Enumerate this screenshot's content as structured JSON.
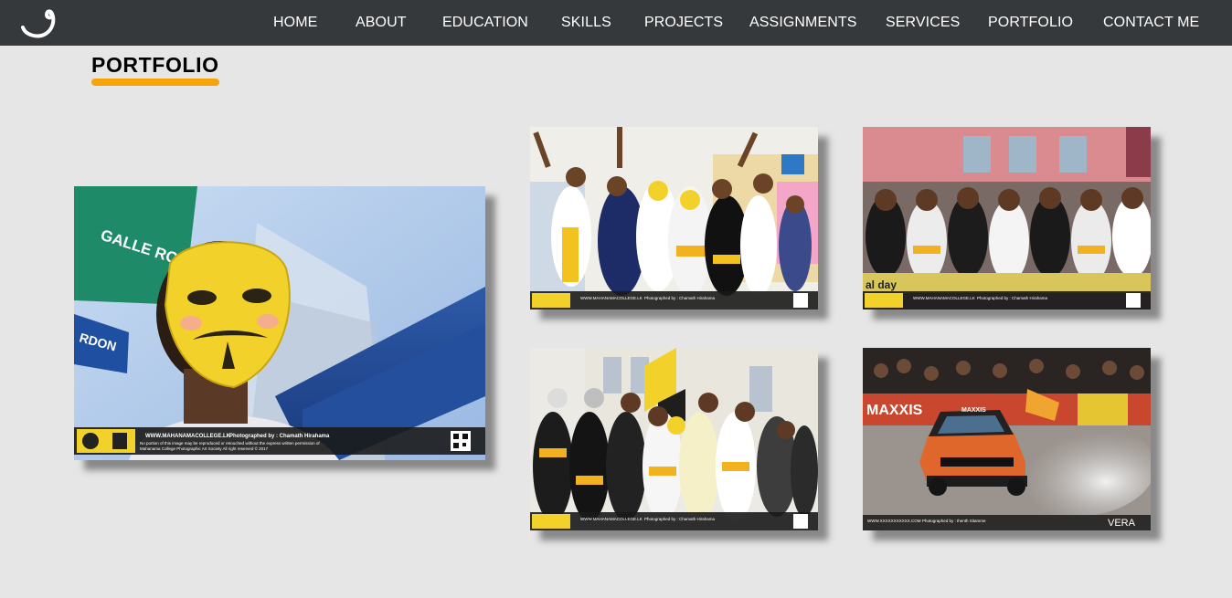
{
  "nav": {
    "items": [
      {
        "label": "HOME"
      },
      {
        "label": "ABOUT"
      },
      {
        "label": "EDUCATION"
      },
      {
        "label": "SKILLS"
      },
      {
        "label": "PROJECTS"
      },
      {
        "label": "ASSIGNMENTS"
      },
      {
        "label": "SERVICES"
      },
      {
        "label": "PORTFOLIO"
      },
      {
        "label": "CONTACT ME"
      }
    ]
  },
  "section": {
    "title": "PORTFOLIO",
    "accent_color": "#f6a40a"
  },
  "photos": {
    "main": {
      "watermark_site": "WWW.MAHANAMACOLLEGE.LK",
      "watermark_credit": "Photographed by : Chamath Hirahama",
      "watermark_notice": "No portion of this image may be reproduced or retouched without the express written permission of",
      "watermark_notice2": "Mahanama College Photographic Art Society All right reserved © 2017",
      "sign_text": "GALLE ROAD",
      "blue_sign_text": "RDON"
    },
    "p1": {
      "watermark_site": "WWW.MAHANAMACOLLEGE.LK",
      "watermark_credit": "Photographed by : Chamath Hirahama"
    },
    "p2": {
      "watermark_site": "WWW.MAHANAMACOLLEGE.LK",
      "watermark_credit": "Photographed by : Chamath Hirahama",
      "banner_text": "al day"
    },
    "p3": {
      "watermark_site": "WWW.MAHANAMACOLLEGE.LK",
      "watermark_credit": "Photographed by : Chamath Hirahama"
    },
    "p4": {
      "watermark_site": "WWW.XXXXXXXXXXX.COM",
      "watermark_credit": "Photographed by : Ihenth Sitamme",
      "brand": "VERA",
      "banner_text": "MAXXIS",
      "car_text": "MAXXIS"
    }
  },
  "icons": {
    "logo": "swirl-logo-icon"
  }
}
